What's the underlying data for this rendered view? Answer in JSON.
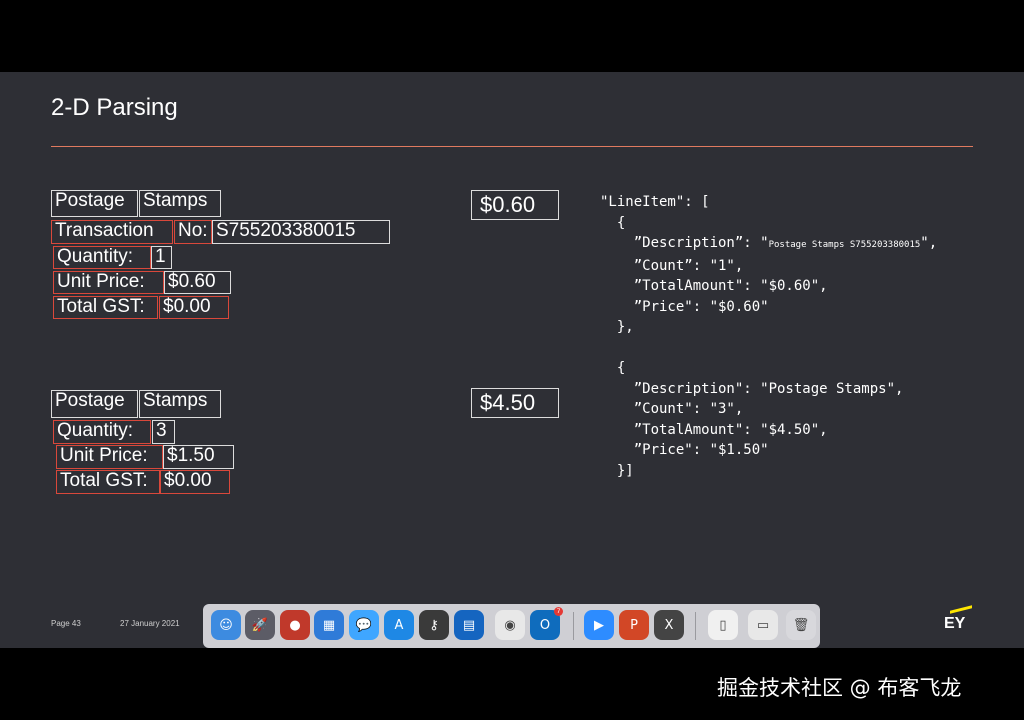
{
  "slide": {
    "title": "2-D Parsing",
    "block1": {
      "postage": "Postage",
      "stamps": "Stamps",
      "transaction": "Transaction",
      "no_label": "No:",
      "no_value": "S755203380015",
      "quantity_label": "Quantity:",
      "quantity_value": "1",
      "unit_price_label": "Unit Price:",
      "unit_price_value": "$0.60",
      "total_gst_label": "Total GST:",
      "total_gst_value": "$0.00",
      "amount": "$0.60"
    },
    "block2": {
      "postage": "Postage",
      "stamps": "Stamps",
      "quantity_label": "Quantity:",
      "quantity_value": "3",
      "unit_price_label": "Unit Price:",
      "unit_price_value": "$1.50",
      "total_gst_label": "Total GST:",
      "total_gst_value": "$0.00",
      "amount": "$4.50"
    },
    "json_lines": {
      "l1": "\"LineItem\": [",
      "l2": "  {",
      "l3a": "    ”Description”: \"",
      "l3b": "Postage Stamps S755203380015",
      "l3c": "\",",
      "l4": "    ”Count”: \"1\",",
      "l5": "    ”TotalAmount\": \"$0.60\",",
      "l6": "    ”Price\": \"$0.60\"",
      "l7": "  },",
      "l8": "  {",
      "l9": "    ”Description\": \"Postage Stamps\",",
      "l10": "    ”Count\": \"3\",",
      "l11": "    ”TotalAmount\": \"$4.50\",",
      "l12": "    ”Price\": \"$1.50\"",
      "l13": "  }]"
    },
    "footer": {
      "page": "Page 43",
      "date": "27 January 2021",
      "logo": "EY"
    }
  },
  "dock": {
    "items": [
      {
        "name": "finder-icon",
        "glyph": "☺",
        "color": "#3d8be0"
      },
      {
        "name": "launchpad-icon",
        "glyph": "🚀",
        "color": "#5c5c66"
      },
      {
        "name": "app-red-icon",
        "glyph": "●",
        "color": "#c0392b"
      },
      {
        "name": "calendar-icon",
        "glyph": "▦",
        "color": "#2f7bd8"
      },
      {
        "name": "messages-icon",
        "glyph": "💬",
        "color": "#3fa6ff"
      },
      {
        "name": "app-store-icon",
        "glyph": "A",
        "color": "#1e88e5"
      },
      {
        "name": "keychain-icon",
        "glyph": "⚷",
        "color": "#3a3a3a"
      },
      {
        "name": "app-blue-icon",
        "glyph": "▤",
        "color": "#1565c0"
      },
      {
        "name": "chrome-icon",
        "glyph": "◉",
        "color": "#e8e8e8"
      },
      {
        "name": "outlook-icon",
        "glyph": "O",
        "color": "#0f6cbd"
      },
      {
        "name": "zoom-icon",
        "glyph": "▶",
        "color": "#2d8cff"
      },
      {
        "name": "powerpoint-icon",
        "glyph": "P",
        "color": "#d24726"
      },
      {
        "name": "xquartz-icon",
        "glyph": "X",
        "color": "#444444"
      },
      {
        "name": "document-icon",
        "glyph": "▯",
        "color": "#f0f0f0"
      },
      {
        "name": "screenshot-icon",
        "glyph": "▭",
        "color": "#e8e8e8"
      },
      {
        "name": "trash-icon",
        "glyph": "🗑",
        "color": "#d8d8dc"
      }
    ],
    "outlook_badge": "7"
  },
  "watermark": "掘金技术社区 @ 布客飞龙"
}
